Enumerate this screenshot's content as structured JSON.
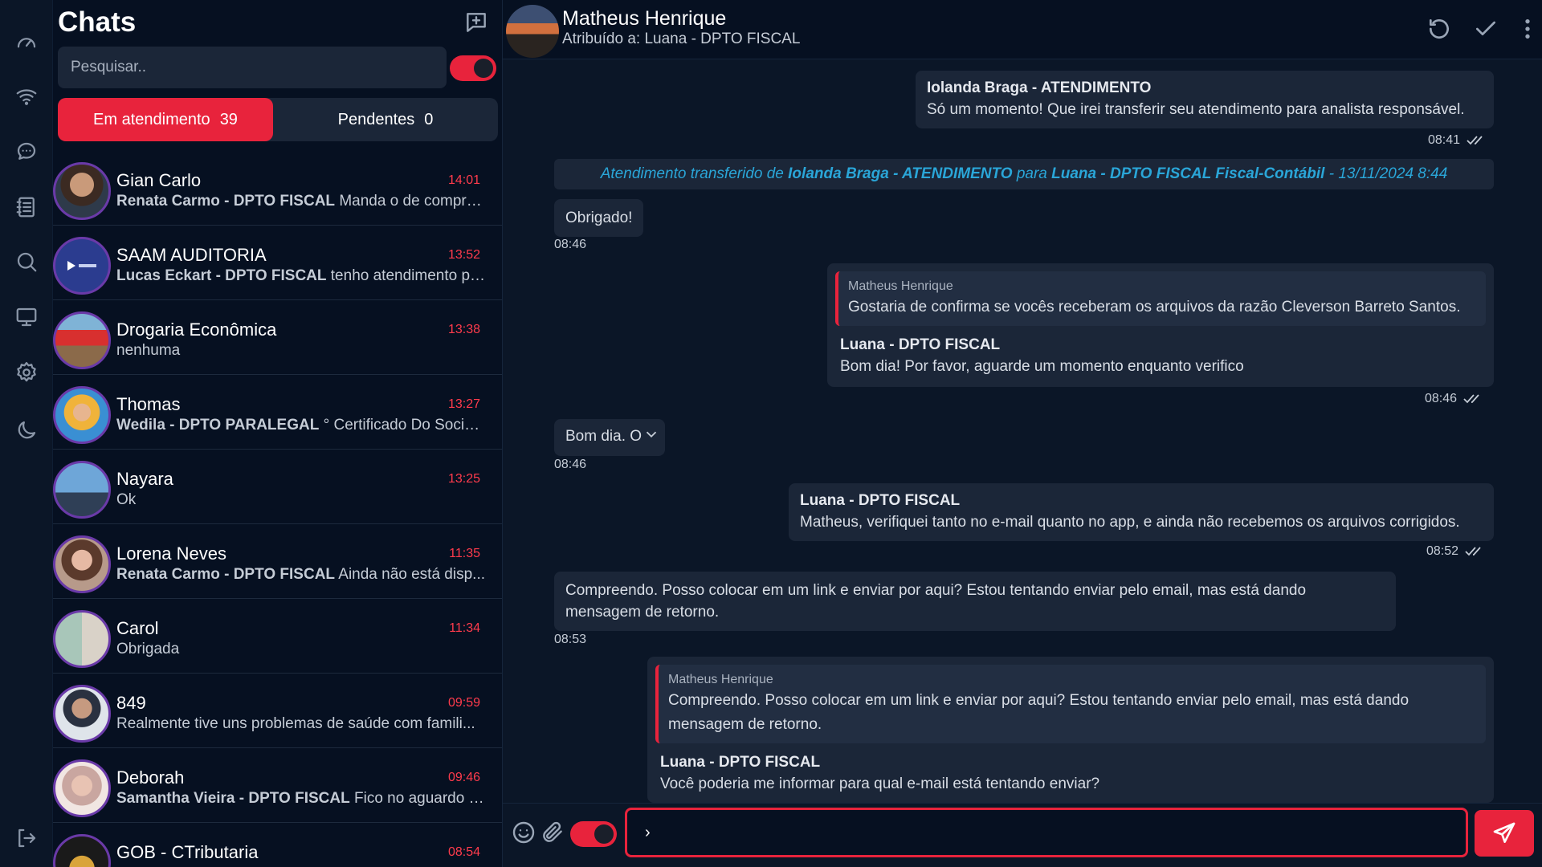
{
  "sidebar": {
    "title": "Chats",
    "search_placeholder": "Pesquisar..",
    "tabs": [
      {
        "label": "Em atendimento",
        "count": "39"
      },
      {
        "label": "Pendentes",
        "count": "0"
      }
    ]
  },
  "chats": [
    {
      "name": "Gian Carlo",
      "time": "14:01",
      "sender": "Renata Carmo - DPTO FISCAL",
      "preview": "Manda o de compras..."
    },
    {
      "name": "SAAM AUDITORIA",
      "time": "13:52",
      "sender": "Lucas Eckart - DPTO FISCAL",
      "preview": "tenho atendimento po..."
    },
    {
      "name": "Drogaria Econômica",
      "time": "13:38",
      "sender": "",
      "preview": "nenhuma"
    },
    {
      "name": "Thomas",
      "time": "13:27",
      "sender": "Wedila - DPTO PARALEGAL",
      "preview": "° Certificado Do Socio , ..."
    },
    {
      "name": "Nayara",
      "time": "13:25",
      "sender": "",
      "preview": "Ok"
    },
    {
      "name": "Lorena Neves",
      "time": "11:35",
      "sender": "Renata Carmo - DPTO FISCAL",
      "preview": "Ainda não está disp..."
    },
    {
      "name": "Carol",
      "time": "11:34",
      "sender": "",
      "preview": "Obrigada"
    },
    {
      "name": "849",
      "time": "09:59",
      "sender": "",
      "preview": "Realmente tive uns problemas de saúde com famili..."
    },
    {
      "name": "Deborah",
      "time": "09:46",
      "sender": "Samantha Vieira - DPTO FISCAL",
      "preview": "Fico no aguardo d..."
    },
    {
      "name": "GOB - CTributaria",
      "time": "08:54",
      "sender": "",
      "preview": ""
    }
  ],
  "conversation": {
    "contact_name": "Matheus Henrique",
    "assigned": "Atribuído a: Luana - DPTO FISCAL",
    "messages": {
      "m1": {
        "sender": "Iolanda Braga - ATENDIMENTO",
        "text": "Só um momento! Que irei transferir seu atendimento para analista responsável.",
        "time": "08:41"
      },
      "transfer": {
        "prefix": "Atendimento transferido de",
        "from": "Iolanda Braga - ATENDIMENTO",
        "mid": "para",
        "to": "Luana - DPTO FISCAL Fiscal-Contábil",
        "suffix": "- 13/11/2024 8:44"
      },
      "m2": {
        "text": "Obrigado!",
        "time": "08:46"
      },
      "m3": {
        "quote_author": "Matheus Henrique",
        "quote_text": "Gostaria de confirma se vocês receberam os arquivos da razão Cleverson Barreto Santos.",
        "sender": "Luana - DPTO FISCAL",
        "text": "Bom dia! Por favor, aguarde um momento enquanto verifico",
        "time": "08:46"
      },
      "m4": {
        "text": "Bom dia. O",
        "time": "08:46"
      },
      "m5": {
        "sender": "Luana - DPTO FISCAL",
        "text": "Matheus, verifiquei tanto no e-mail quanto no app, e ainda não recebemos os arquivos corrigidos.",
        "time": "08:52"
      },
      "m6": {
        "text": "Compreendo. Posso colocar em um link e enviar por aqui? Estou tentando enviar pelo email, mas está dando mensagem de retorno.",
        "time": "08:53"
      },
      "m7": {
        "quote_author": "Matheus Henrique",
        "quote_text": "Compreendo. Posso colocar em um link e enviar por aqui? Estou tentando enviar pelo email, mas está dando mensagem de retorno.",
        "sender": "Luana - DPTO FISCAL",
        "text": "Você poderia me informar para qual e-mail está tentando enviar?"
      }
    }
  },
  "composer": {
    "value": "›"
  },
  "colors": {
    "accent": "#e8233c",
    "background": "#061021",
    "bubble": "#1b2638",
    "link": "#2aa6d8",
    "time": "#ff3b4c"
  },
  "icons": [
    "dashboard-icon",
    "wifi-icon",
    "chat-icon",
    "contacts-icon",
    "search-icon",
    "monitor-icon",
    "settings-icon",
    "moon-icon",
    "logout-icon",
    "new-chat-icon",
    "refresh-icon",
    "check-icon",
    "more-icon",
    "emoji-icon",
    "attach-icon",
    "send-icon"
  ]
}
